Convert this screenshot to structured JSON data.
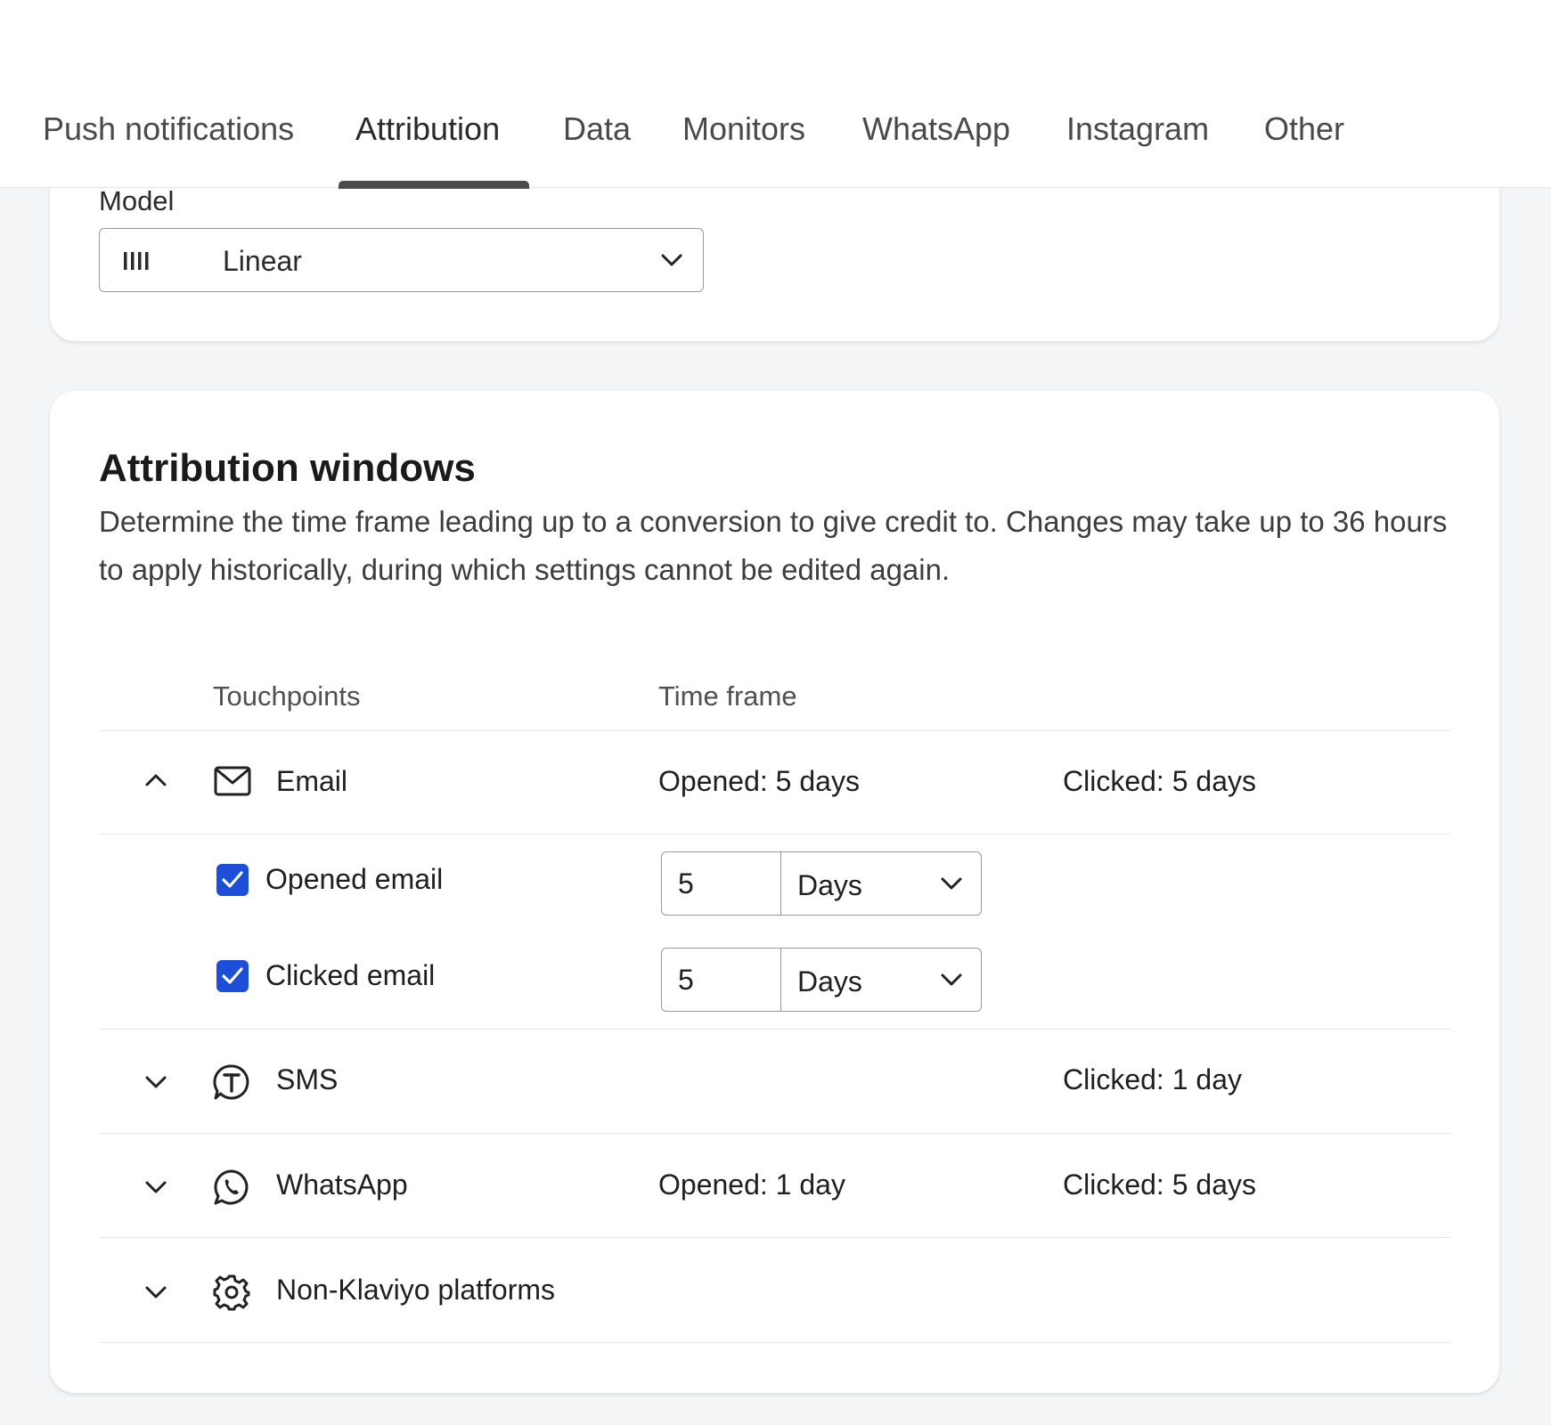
{
  "tabs": [
    {
      "label": "Push notifications"
    },
    {
      "label": "Attribution"
    },
    {
      "label": "Data"
    },
    {
      "label": "Monitors"
    },
    {
      "label": "WhatsApp"
    },
    {
      "label": "Instagram"
    },
    {
      "label": "Other"
    }
  ],
  "active_tab": "Attribution",
  "model": {
    "label": "Model",
    "selected": "Linear"
  },
  "attribution_windows": {
    "title": "Attribution windows",
    "description": "Determine the time frame leading up to a conversion to give credit to. Changes may take up to 36 hours to apply historically, during which settings cannot be edited again.",
    "columns": {
      "touchpoints": "Touchpoints",
      "time_frame": "Time frame"
    },
    "rows": [
      {
        "name": "Email",
        "icon": "mail-icon",
        "expanded": true,
        "opened": "Opened: 5 days",
        "clicked": "Clicked: 5 days"
      },
      {
        "name": "SMS",
        "icon": "sms-icon",
        "expanded": false,
        "opened": "",
        "clicked": "Clicked: 1 day"
      },
      {
        "name": "WhatsApp",
        "icon": "whatsapp-icon",
        "expanded": false,
        "opened": "Opened: 1 day",
        "clicked": "Clicked: 5 days"
      },
      {
        "name": "Non-Klaviyo platforms",
        "icon": "gear-icon",
        "expanded": false,
        "opened": "",
        "clicked": ""
      }
    ],
    "email_settings": [
      {
        "label": "Opened email",
        "checked": true,
        "value": "5",
        "unit": "Days"
      },
      {
        "label": "Clicked email",
        "checked": true,
        "value": "5",
        "unit": "Days"
      }
    ]
  },
  "colors": {
    "checkbox_accent": "#1d4ed8",
    "tab_indicator": "#4b4b4b",
    "page_background": "#f4f5f6"
  }
}
